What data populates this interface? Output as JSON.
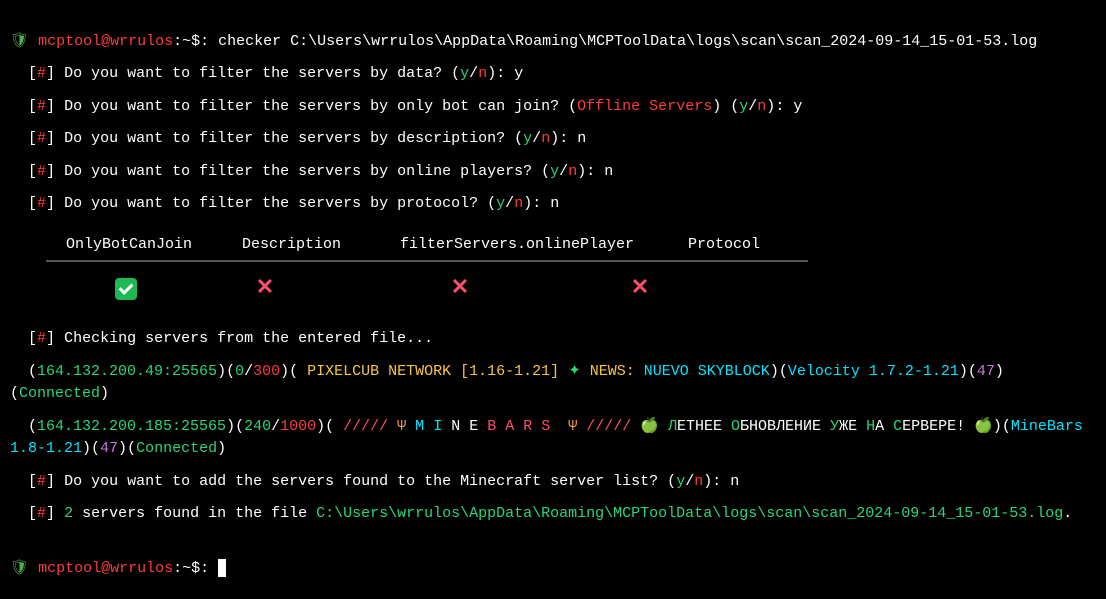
{
  "prompt1": {
    "shield": "🛡",
    "user": "mcptool@wrrulos",
    "sep": ":~$: ",
    "cmd": "checker C:\\Users\\wrrulos\\AppData\\Roaming\\MCPToolData\\logs\\scan\\scan_2024-09-14_15-01-53.log"
  },
  "q": {
    "pre": "  [",
    "hash": "#",
    "post": "] ",
    "lp": "(",
    "rp": ")",
    "y": "y",
    "slash": "/",
    "n": "n",
    "colon": ": "
  },
  "q1": {
    "text": "Do you want to filter the servers by data? ",
    "ans": "y"
  },
  "q2": {
    "text": "Do you want to filter the servers by only bot can join? ",
    "label": "Offline Servers",
    "ans": "y"
  },
  "q3": {
    "text": "Do you want to filter the servers by description? ",
    "ans": "n"
  },
  "q4": {
    "text": "Do you want to filter the servers by online players? ",
    "ans": "n"
  },
  "q5": {
    "text": "Do you want to filter the servers by protocol? ",
    "ans": "n"
  },
  "table": {
    "h1": "OnlyBotCanJoin",
    "h2": "Description",
    "h3": "filterServers.onlinePlayer",
    "h4": "Protocol"
  },
  "checking": "Checking servers from the entered file...",
  "srv1": {
    "pre": "  (",
    "ip": "164.132.200.49:25565",
    "sep": ")(",
    "online": "0",
    "slash": "/",
    "max": "300",
    "desc_a": " PIXELCUB NETWORK [1.16-1.21] ",
    "star": "✦",
    "desc_b": " NEWS: ",
    "desc_c": "NUEVO SKYBLOCK",
    "ver": "Velocity 1.7.2-1.21",
    "proto": "47",
    "status": "Connected",
    "close": ")"
  },
  "srv2": {
    "pre": "  (",
    "ip": "164.132.200.185:25565",
    "sep": ")(",
    "online": "240",
    "slash": "/",
    "max": "1000",
    "slashes1": " ///// ",
    "psi1": "Ψ ",
    "m": "M ",
    "i": "I ",
    "ne": "N E ",
    "b": "B ",
    "a": "A ",
    "r": "R ",
    "s": "S ",
    "psi2": " Ψ",
    "slashes2": " ///// ",
    "apple": "🍏",
    "ru_l": " Л",
    "ru_letnee": "ЕТНЕЕ ",
    "ru_o": "О",
    "ru_bnov": "БНОВЛЕНИЕ ",
    "ru_u": "У",
    "ru_zhe": "ЖЕ ",
    "ru_n": "Н",
    "ru_a": "А ",
    "ru_s": "С",
    "ru_erver": "ЕРВЕРЕ! ",
    "ver": "MineBars 1.8-1.21",
    "proto": "47",
    "status": "Connected",
    "close": ")"
  },
  "q6": {
    "text": "Do you want to add the servers found to the Minecraft server list? ",
    "ans": "n"
  },
  "summary": {
    "count": "2",
    "text": " servers found in the file ",
    "path": "C:\\Users\\wrrulos\\AppData\\Roaming\\MCPToolData\\logs\\scan\\scan_2024-09-14_15-01-53.log",
    "dot": "."
  },
  "prompt2": {
    "shield": "🛡",
    "user": "mcptool@wrrulos",
    "sep": ":~$: "
  }
}
